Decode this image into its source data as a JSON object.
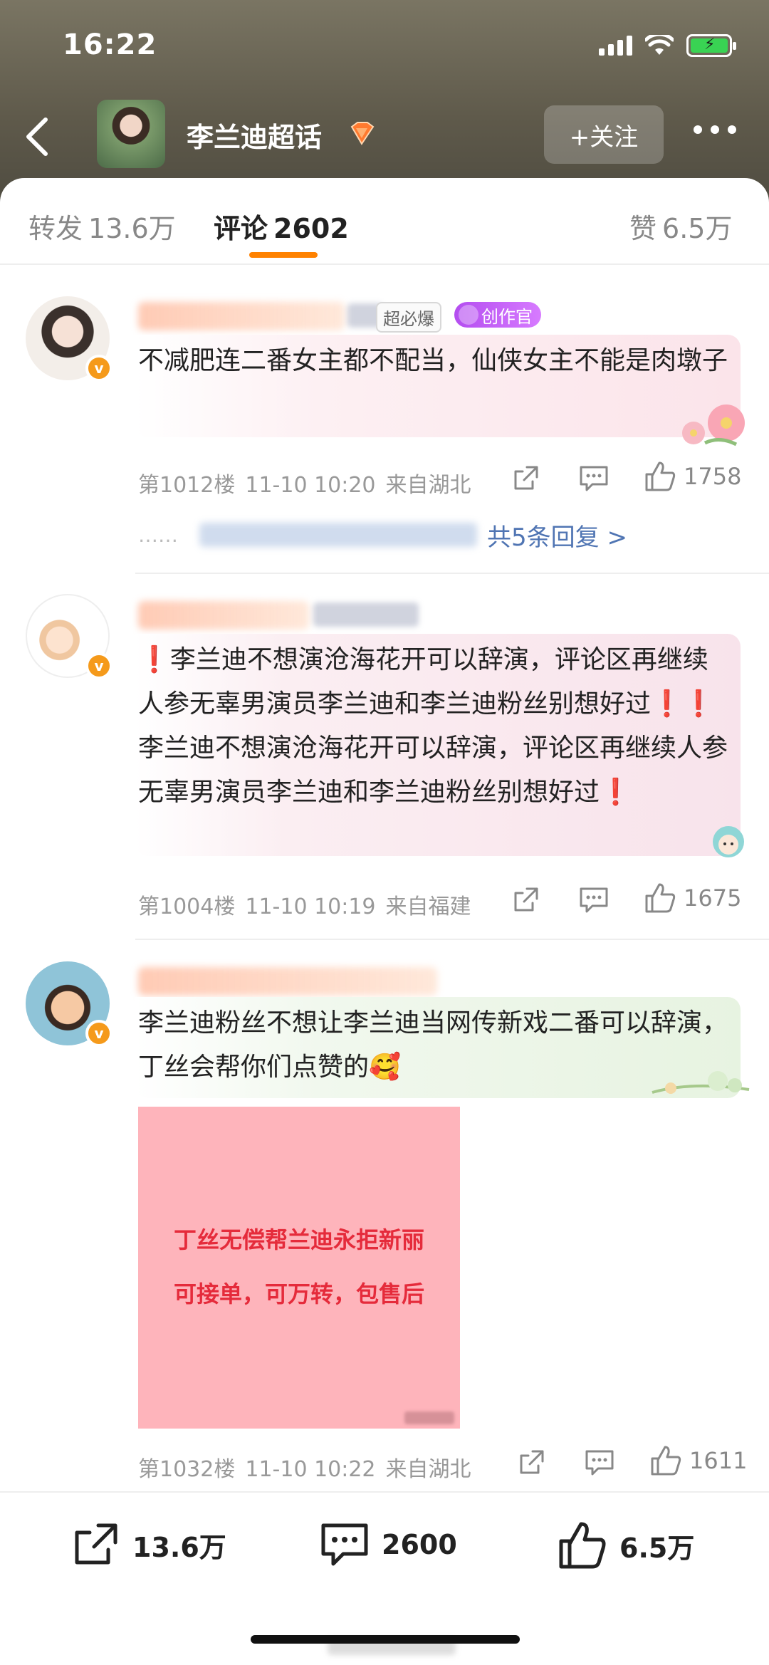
{
  "status_bar": {
    "time": "16:22"
  },
  "header": {
    "title": "李兰迪超话",
    "follow_label": "+关注"
  },
  "tabs": [
    {
      "label": "转发",
      "count": "13.6万"
    },
    {
      "label": "评论",
      "count": "2602"
    },
    {
      "label": "赞",
      "count": "6.5万"
    }
  ],
  "comments": [
    {
      "tag_text": "超必爆",
      "badge_label": "创作官",
      "text": "不减肥连二番女主都不配当，仙侠女主不能是肉墩子",
      "floor": "第1012楼",
      "time": "11-10 10:20",
      "location": "来自湖北",
      "likes": "1758",
      "replies_label": "共5条回复 >"
    },
    {
      "text": "❗李兰迪不想演沧海花开可以辞演，评论区再继续人参无辜男演员李兰迪和李兰迪粉丝别想好过❗❗李兰迪不想演沧海花开可以辞演，评论区再继续人参无辜男演员李兰迪和李兰迪粉丝别想好过❗",
      "floor": "第1004楼",
      "time": "11-10 10:19",
      "location": "来自福建",
      "likes": "1675"
    },
    {
      "text": "李兰迪粉丝不想让李兰迪当网传新戏二番可以辞演，丁丝会帮你们点赞的🥰",
      "image_line1": "丁丝无偿帮兰迪永拒新丽",
      "image_line2": "可接单，可万转，包售后",
      "floor": "第1032楼",
      "time": "11-10 10:22",
      "location": "来自湖北",
      "likes": "1611"
    }
  ],
  "bottom_bar": {
    "repost": "13.6万",
    "comment": "2600",
    "like": "6.5万"
  },
  "colors": {
    "accent": "#ff8200",
    "reply_link": "#5075b3",
    "verified_badge": "#f59a1b",
    "image_bg": "#feb4bb",
    "image_text": "#e52b3b"
  }
}
